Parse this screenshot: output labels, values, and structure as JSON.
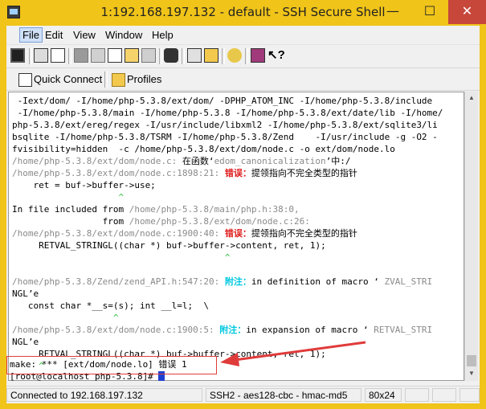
{
  "title": "1:192.168.197.132 - default - SSH Secure Shell",
  "window_buttons": {
    "minimize": "—",
    "maximize": "☐",
    "close": "✕"
  },
  "menu": [
    "File",
    "Edit",
    "View",
    "Window",
    "Help"
  ],
  "quick_connect": {
    "label": "Quick Connect"
  },
  "profiles": {
    "label": "Profiles"
  },
  "terminal": {
    "l1": " -Iext/dom/ -I/home/php-5.3.8/ext/dom/ -DPHP_ATOM_INC -I/home/php-5.3.8/include",
    "l2": " -I/home/php-5.3.8/main -I/home/php-5.3.8 -I/home/php-5.3.8/ext/date/lib -I/home/",
    "l3": "php-5.3.8/ext/ereg/regex -I/usr/include/libxml2 -I/home/php-5.3.8/ext/sqlite3/li",
    "l4": "bsqlite -I/home/php-5.3.8/TSRM -I/home/php-5.3.8/Zend    -I/usr/include -g -O2 -",
    "l5": "fvisibility=hidden  -c /home/php-5.3.8/ext/dom/node.c -o ext/dom/node.lo",
    "l6a": "/home/php-5.3.8/ext/dom/node.c:",
    "l6b": " 在函数‘",
    "l6c": "edom_canonicalization",
    "l6d": "’中:/",
    "l7a": "/home/php-5.3.8/ext/dom/node.c:1898:21: ",
    "l7b": "错误：",
    "l7c": "提领指向不完全类型的指针",
    "l8": "    ret = buf->buffer->use;",
    "l9": "                    ^",
    "l10": "In file included from ",
    "l10b": "/home/php-5.3.8/main/php.h:38:0,",
    "l11": "                 from ",
    "l11b": "/home/php-5.3.8/ext/dom/node.c:26:",
    "l12a": "/home/php-5.3.8/ext/dom/node.c:1900:40: ",
    "l12b": "错误：",
    "l12c": "提领指向不完全类型的指针",
    "l13": "     RETVAL_STRINGL((char *) buf->buffer->content, ret, 1);",
    "l14": "                                        ^",
    "l15a": "/home/php-5.3.8/Zend/zend_API.h:547:20: ",
    "l15b": "附注：",
    "l15c": "in definition of macro ‘",
    "l15d": " ZVAL_STRI",
    "l16": "NGL’e",
    "l17": "   const char *__s=(s); int __l=l;  \\",
    "l18": "                   ^",
    "l19a": "/home/php-5.3.8/ext/dom/node.c:1900:5: ",
    "l19b": "附注：",
    "l19c": "in expansion of macro ‘",
    "l19d": " RETVAL_STRI",
    "l20": "NGL’e",
    "l21": "     RETVAL_STRINGL((char *) buf->buffer->content, ret, 1);",
    "l22": "     ^",
    "l23": "make: *** [ext/dom/node.lo] 错误 1",
    "l24": "[root@localhost php-5.3.8]# "
  },
  "status": {
    "connected": "Connected to 192.168.197.132",
    "cipher": "SSH2 - aes128-cbc - hmac-md5",
    "size": "80x24"
  },
  "colors": {
    "titlebar": "#f0c419",
    "error": "#e02020",
    "note": "#00c8e0",
    "caret": "#30c040",
    "cursor": "#2040d0"
  }
}
